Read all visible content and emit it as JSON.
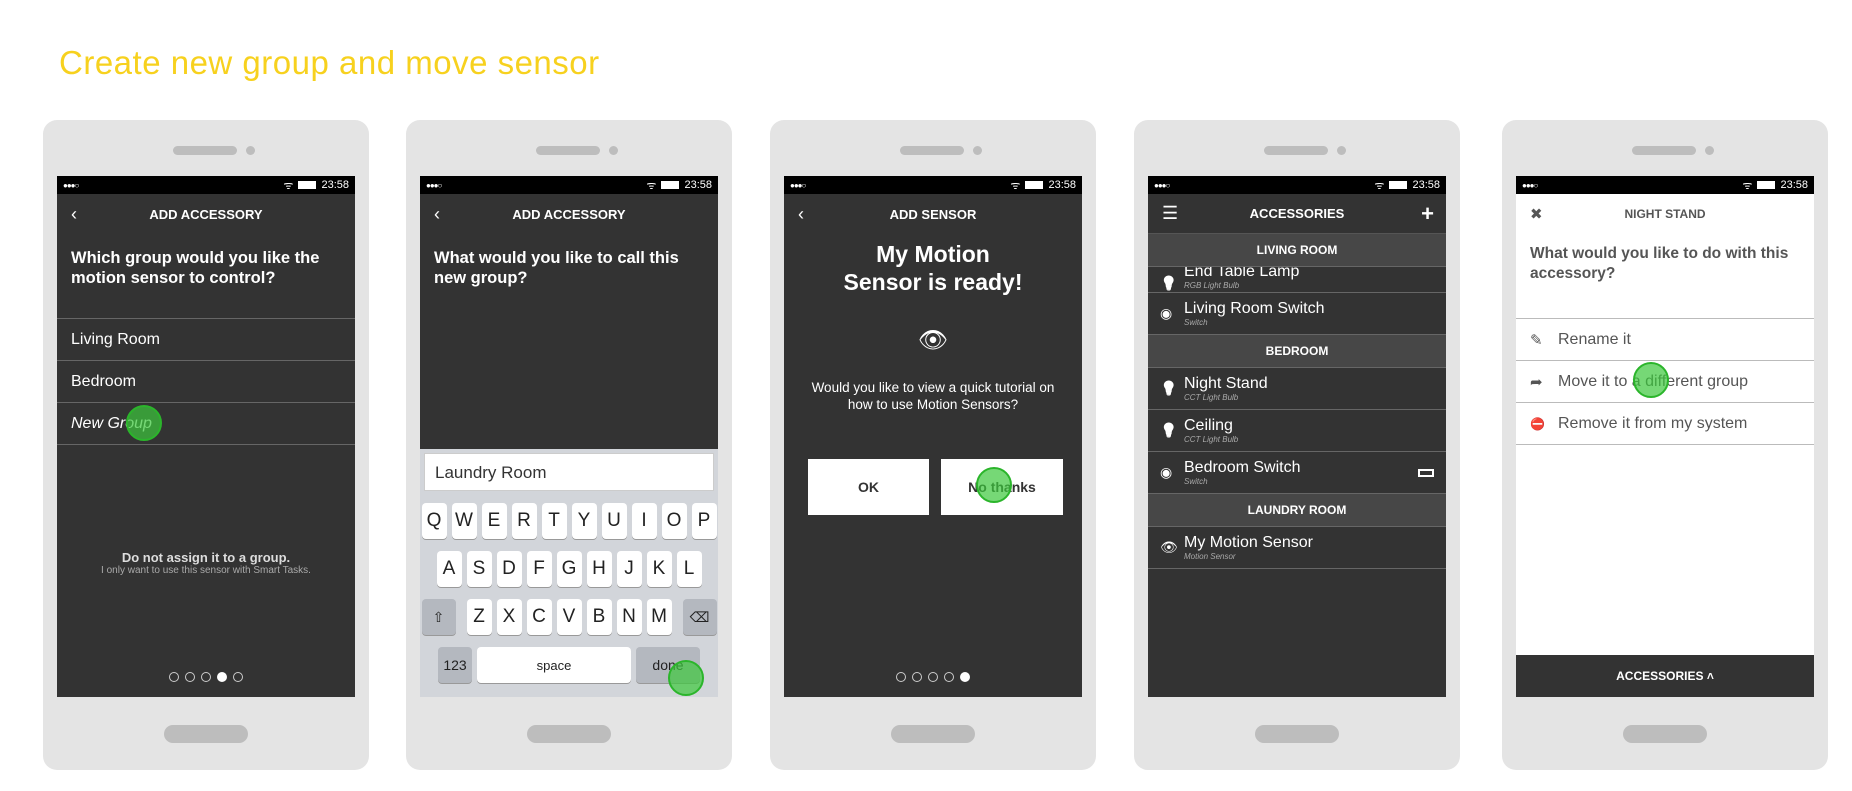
{
  "title": "Create new group and move sensor",
  "status": {
    "signal": "●●●○",
    "time": "23:58"
  },
  "s1": {
    "header": "ADD ACCESSORY",
    "back": "‹",
    "question": "Which group would you like the motion sensor to control?",
    "options": [
      "Living Room",
      "Bedroom",
      "New Group"
    ],
    "no_group_title": "Do not assign it to a group.",
    "no_group_sub": "I only want to use this sensor with Smart Tasks.",
    "page": 4,
    "pages": 5
  },
  "s2": {
    "header": "ADD ACCESSORY",
    "back": "‹",
    "question": "What would you like to call this new group?",
    "input_value": "Laundry Room",
    "row1": [
      "Q",
      "W",
      "E",
      "R",
      "T",
      "Y",
      "U",
      "I",
      "O",
      "P"
    ],
    "row2": [
      "A",
      "S",
      "D",
      "F",
      "G",
      "H",
      "J",
      "K",
      "L"
    ],
    "row3": [
      "Z",
      "X",
      "C",
      "V",
      "B",
      "N",
      "M"
    ],
    "shift": "⇧",
    "delete": "⌫",
    "num": "123",
    "space": "space",
    "done": "done"
  },
  "s3": {
    "header": "ADD SENSOR",
    "back": "‹",
    "title": "My Motion Sensor is ready!",
    "icon": "👁",
    "text": "Would you like to view a quick tutorial on how to use Motion Sensors?",
    "ok": "OK",
    "no": "No thanks",
    "page": 5,
    "pages": 5
  },
  "s4": {
    "header": "ACCESSORIES",
    "menu": "☰",
    "add": "+",
    "sections": [
      {
        "name": "LIVING ROOM",
        "items": [
          {
            "name": "End Table Lamp",
            "type": "RGB Light Bulb",
            "icon": "bulb"
          },
          {
            "name": "Living Room Switch",
            "type": "Switch",
            "icon": "switch"
          }
        ]
      },
      {
        "name": "BEDROOM",
        "items": [
          {
            "name": "Night Stand",
            "type": "CCT Light Bulb",
            "icon": "bulb"
          },
          {
            "name": "Ceiling",
            "type": "CCT Light Bulb",
            "icon": "bulb"
          },
          {
            "name": "Bedroom Switch",
            "type": "Switch",
            "icon": "switch",
            "low_battery": true
          }
        ]
      },
      {
        "name": "LAUNDRY ROOM",
        "items": [
          {
            "name": "My Motion Sensor",
            "type": "Motion Sensor",
            "icon": "eye"
          }
        ]
      }
    ]
  },
  "s5": {
    "header": "NIGHT STAND",
    "close": "✖",
    "question": "What would you like to do with this accessory?",
    "actions": [
      {
        "label": "Rename it",
        "icon": "✎"
      },
      {
        "label": "Move it to a different group",
        "icon": "➦"
      },
      {
        "label": "Remove it from my system",
        "icon": "⛔"
      }
    ],
    "footer": "ACCESSORIES ˄"
  },
  "colors": {
    "accent": "#f7d11e",
    "tap": "#3cc83c",
    "screen": "#333333"
  }
}
